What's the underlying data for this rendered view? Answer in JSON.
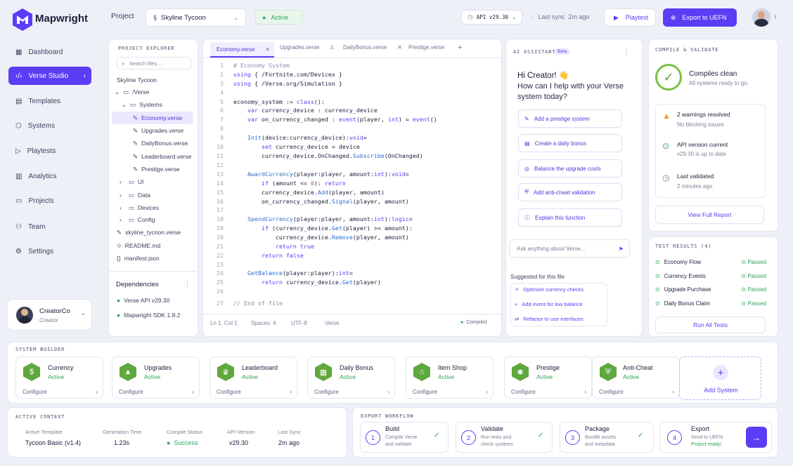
{
  "app": {
    "name": "Mapwright"
  },
  "sidebar": {
    "items": [
      {
        "label": "Dashboard"
      },
      {
        "label": "Verse Studio"
      },
      {
        "label": "Templates"
      },
      {
        "label": "Systems"
      },
      {
        "label": "Playtests"
      },
      {
        "label": "Analytics"
      },
      {
        "label": "Projects"
      },
      {
        "label": "Team"
      },
      {
        "label": "Settings"
      }
    ],
    "user": {
      "name": "CreatorCo",
      "role": "Creator"
    }
  },
  "topbar": {
    "project_label": "Project",
    "project_value": "Skyline Tycoon",
    "status": "Active",
    "api": "API v29.30",
    "last_sync": "Last sync  2m ago",
    "playtest": "Playtest",
    "export": "Export to UEFN"
  },
  "explorer": {
    "title": "PROJECT EXPLORER",
    "search_placeholder": "Search files...",
    "root": "Skyline Tycoon",
    "verse": "/Verse",
    "systems": "Systems",
    "files": [
      "Economy.verse",
      "Upgrades.verse",
      "DailyBonus.verse",
      "Leaderboard.verse",
      "Prestige.verse"
    ],
    "folders": [
      "UI",
      "Data",
      "Devices",
      "Config"
    ],
    "root_files": [
      "skyline_tycoon.verse",
      "README.md",
      "manifest.json"
    ],
    "deps_title": "Dependencies",
    "deps": [
      "Verse API v29.30",
      "Mapwright SDK 1.8.2"
    ]
  },
  "editor": {
    "tabs": [
      "Economy.verse",
      "Upgrades.verse",
      "DailyBonus.verse",
      "Prestige.verse"
    ],
    "status": {
      "pos": "Ln 1, Col 1",
      "spaces": "Spaces: 4",
      "enc": "UTF-8",
      "lang": "Verse",
      "compiled": "Compiled"
    }
  },
  "assistant": {
    "title": "AI ASSISTANT",
    "badge": "Beta",
    "greeting": "Hi Creator! 👋",
    "question": "How can I help with your Verse system today?",
    "suggestions": [
      "Add a prestige system",
      "Create a daily bonus",
      "Balance the upgrade costs",
      "Add anti-cheat validation",
      "Explain this function"
    ],
    "input_placeholder": "Ask anything about Verse...",
    "suggested_title": "Suggested for this file",
    "suggested": [
      "Optimize currency checks",
      "Add event for low balance",
      "Refactor to use interfaces"
    ]
  },
  "compile": {
    "title": "COMPILE & VALIDATE",
    "status": "Compiles clean",
    "sub": "All systems ready to go.",
    "checks": [
      {
        "title": "2 warnings resolved",
        "sub": "No blocking issues"
      },
      {
        "title": "API version current",
        "sub": "v29.30 is up to date"
      },
      {
        "title": "Last validated",
        "sub": "2 minutes ago"
      }
    ],
    "report_btn": "View Full Report"
  },
  "tests": {
    "title": "TEST RESULTS (4)",
    "items": [
      {
        "name": "Economy Flow",
        "status": "Passed"
      },
      {
        "name": "Currency Events",
        "status": "Passed"
      },
      {
        "name": "Upgrade Purchase",
        "status": "Passed"
      },
      {
        "name": "Daily Bonus Claim",
        "status": "Passed"
      }
    ],
    "run_btn": "Run All Tests"
  },
  "system_builder": {
    "title": "SYSTEM BUILDER",
    "cards": [
      {
        "name": "Currency",
        "status": "Active",
        "action": "Configure"
      },
      {
        "name": "Upgrades",
        "status": "Active",
        "action": "Configure"
      },
      {
        "name": "Leaderboard",
        "status": "Active",
        "action": "Configure"
      },
      {
        "name": "Daily Bonus",
        "status": "Active",
        "action": "Configure"
      },
      {
        "name": "Item Shop",
        "status": "Active",
        "action": "Configure"
      },
      {
        "name": "Prestige",
        "status": "Active",
        "action": "Configure"
      },
      {
        "name": "Anti-Cheat",
        "status": "Active",
        "action": "Configure"
      }
    ],
    "add": "Add System"
  },
  "active_context": {
    "title": "ACTIVE CONTEXT",
    "fields": [
      {
        "label": "Active Template",
        "value": "Tycoon Basic (v1.4)"
      },
      {
        "label": "Generation Time",
        "value": "1.23s"
      },
      {
        "label": "Compile Status",
        "value": "Success"
      },
      {
        "label": "API Version",
        "value": "v29.30"
      },
      {
        "label": "Last Sync",
        "value": "2m ago"
      }
    ]
  },
  "export_workflow": {
    "title": "EXPORT WORKFLOW",
    "steps": [
      {
        "num": "1",
        "title": "Build",
        "sub1": "Compile Verse",
        "sub2": "and validate"
      },
      {
        "num": "2",
        "title": "Validate",
        "sub1": "Run tests and",
        "sub2": "check systems"
      },
      {
        "num": "3",
        "title": "Package",
        "sub1": "Bundle assets",
        "sub2": "and metadata"
      },
      {
        "num": "4",
        "title": "Export",
        "sub1": "Send to UEFN",
        "sub2": "Project ready!"
      }
    ]
  },
  "colors": {
    "accent": "#5b3df5",
    "success": "#2fa35b",
    "hex_green": "#5fa83d"
  }
}
